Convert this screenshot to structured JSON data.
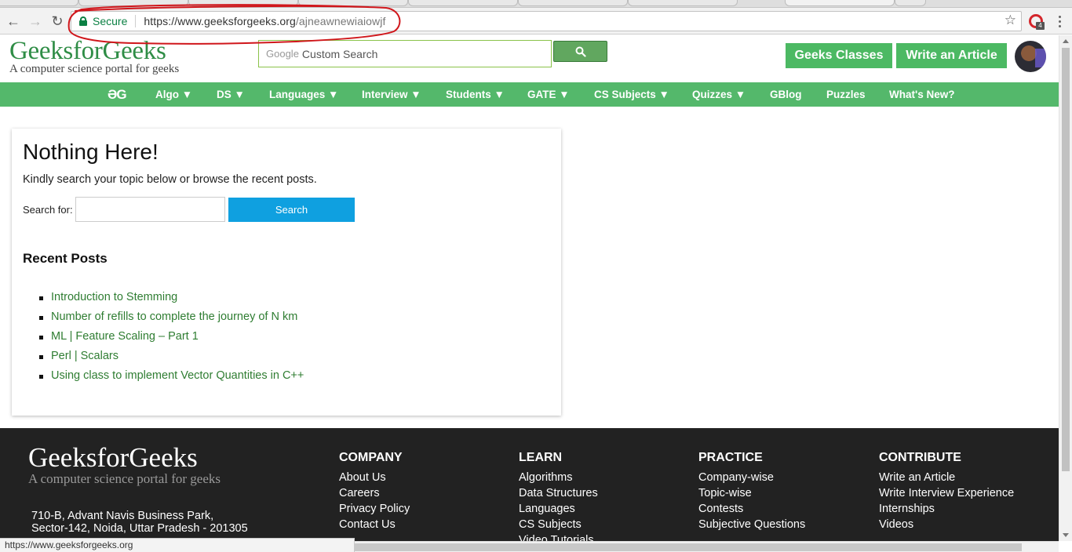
{
  "browser": {
    "secure_label": "Secure",
    "url_base": "https://www.geeksforgeeks.org",
    "url_path": "/ajneawnewiaiowjf",
    "extension_badge": "4",
    "status_url": "https://www.geeksforgeeks.org"
  },
  "header": {
    "logo_title": "GeeksforGeeks",
    "logo_tagline": "A computer science portal for geeks",
    "search_brand": "Google",
    "search_placeholder": "Custom Search",
    "classes_button": "Geeks Classes",
    "write_button": "Write an Article"
  },
  "nav": {
    "home": "ƏG",
    "items": [
      "Algo ▼",
      "DS ▼",
      "Languages ▼",
      "Interview ▼",
      "Students ▼",
      "GATE ▼",
      "CS Subjects ▼",
      "Quizzes ▼",
      "GBlog",
      "Puzzles",
      "What's New?"
    ]
  },
  "content": {
    "heading": "Nothing Here!",
    "lead": "Kindly search your topic below or browse the recent posts.",
    "search_label": "Search for:",
    "search_value": "",
    "search_button": "Search",
    "recent_heading": "Recent Posts",
    "recent_posts": [
      "Introduction to Stemming",
      "Number of refills to complete the journey of N km",
      "ML | Feature Scaling – Part 1",
      "Perl | Scalars",
      "Using class to implement Vector Quantities in C++"
    ]
  },
  "footer": {
    "logo_title": "GeeksforGeeks",
    "logo_tagline": "A computer science portal for geeks",
    "address_line1": "710-B, Advant Navis Business Park,",
    "address_line2": "Sector-142, Noida, Uttar Pradesh - 201305",
    "columns": [
      {
        "title": "COMPANY",
        "links": [
          "About Us",
          "Careers",
          "Privacy Policy",
          "Contact Us"
        ]
      },
      {
        "title": "LEARN",
        "links": [
          "Algorithms",
          "Data Structures",
          "Languages",
          "CS Subjects",
          "Video Tutorials"
        ]
      },
      {
        "title": "PRACTICE",
        "links": [
          "Company-wise",
          "Topic-wise",
          "Contests",
          "Subjective Questions"
        ]
      },
      {
        "title": "CONTRIBUTE",
        "links": [
          "Write an Article",
          "Write Interview Experience",
          "Internships",
          "Videos"
        ]
      }
    ]
  },
  "colors": {
    "brand_green": "#2f8d46",
    "nav_green": "#54b86b",
    "button_green": "#4cb963",
    "search_blue": "#0fa0e0",
    "footer_bg": "#222222",
    "annotation_red": "#d0161b"
  }
}
